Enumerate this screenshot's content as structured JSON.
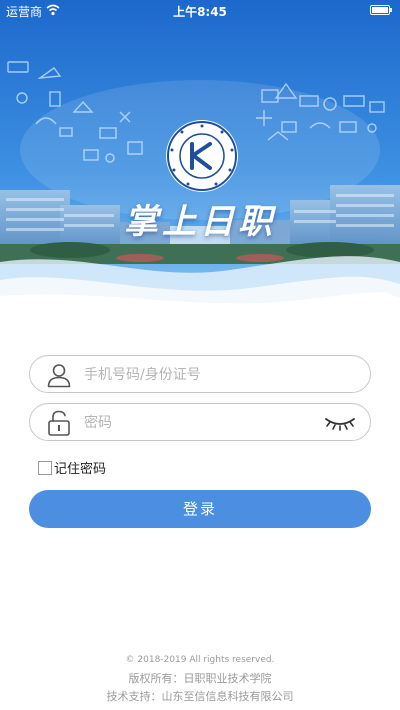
{
  "status_bar": {
    "carrier": "运营商",
    "time": "上午8:45"
  },
  "header": {
    "app_title": "掌上日职",
    "emblem_name": "school-emblem",
    "emblem_text": "日照职业技术学院 RIZHAO POLYTECHNIC"
  },
  "login_form": {
    "phone_placeholder": "手机号码/身份证号",
    "password_placeholder": "密码",
    "remember_label": "记住密码",
    "remember_checked": false,
    "login_button": "登录"
  },
  "footer": {
    "copyright": "© 2018-2019 All rights reserved.",
    "owner": "版权所有：日职职业技术学院",
    "support": "技术支持：山东至信信息科技有限公司"
  },
  "colors": {
    "accent": "#4c8fe1",
    "hero_sky_top": "#1f6fd1",
    "hero_sky_bottom": "#6fb6ef",
    "border": "#c9c9c9",
    "footer_text": "#9a9a9a"
  }
}
